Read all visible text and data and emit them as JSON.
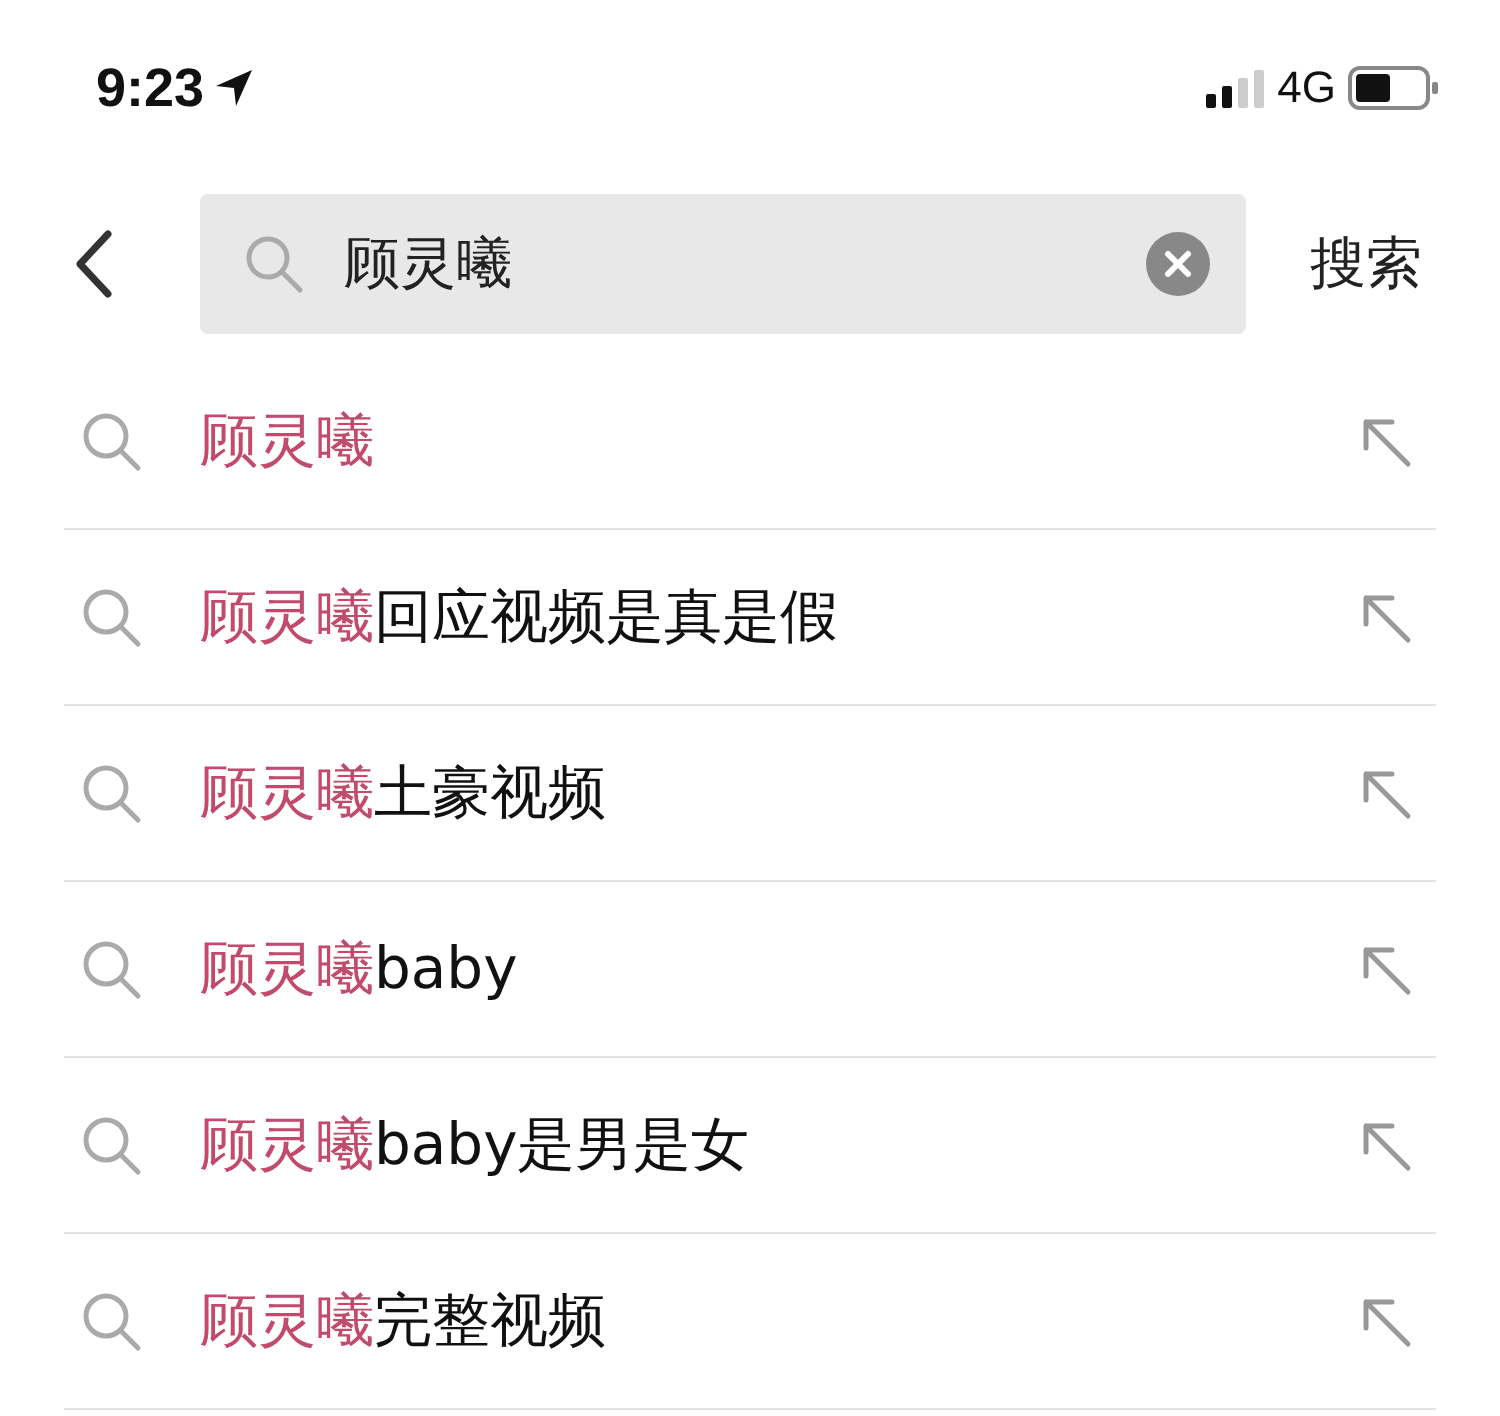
{
  "status_bar": {
    "time": "9:23",
    "network": "4G"
  },
  "search": {
    "value": "顾灵曦",
    "submit": "搜索"
  },
  "suggestions": [
    {
      "match": "顾灵曦"
    },
    {
      "match": "顾灵曦",
      "rest": "回应视频是真是假"
    },
    {
      "match": "顾灵曦",
      "rest": "土豪视频"
    },
    {
      "match": "顾灵曦",
      "rest": "baby"
    },
    {
      "match": "顾灵曦",
      "rest": "baby是男是女"
    },
    {
      "match": "顾灵曦",
      "rest": "完整视频"
    }
  ]
}
